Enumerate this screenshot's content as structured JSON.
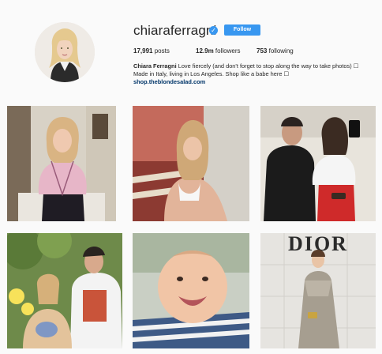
{
  "profile": {
    "username": "chiaraferragni",
    "verified_icon": "verified-badge-icon",
    "follow_label": "Follow",
    "stats": {
      "posts_count": "17,991",
      "posts_label": "posts",
      "followers_count": "12.9m",
      "followers_label": "followers",
      "following_count": "753",
      "following_label": "following"
    },
    "bio": {
      "name": "Chiara Ferragni",
      "line1": "Love fiercely (and don't forget to stop along the way to take photos) ☐",
      "line2": "Made in Italy, living in Los Angeles. Shop like a babe here ☐",
      "link": "shop.theblondesalad.com"
    }
  },
  "posts": [
    {
      "name": "post-woman-pink-sweater"
    },
    {
      "name": "post-woman-white-swimsuit"
    },
    {
      "name": "post-couple-kissing"
    },
    {
      "name": "post-family-photo"
    },
    {
      "name": "post-smiling-baby"
    },
    {
      "name": "post-dior-event"
    }
  ],
  "colors": {
    "accent": "#3897f0",
    "link": "#003569",
    "background": "#fafafa"
  }
}
